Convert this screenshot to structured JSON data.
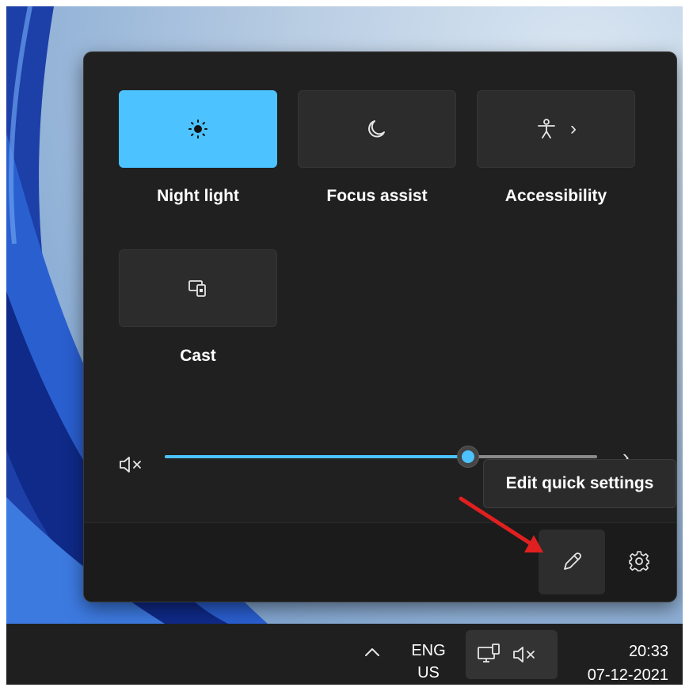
{
  "quick_settings": {
    "tiles": [
      {
        "label": "Night light",
        "icon": "night-light-icon",
        "active": true
      },
      {
        "label": "Focus assist",
        "icon": "moon-icon",
        "active": false
      },
      {
        "label": "Accessibility",
        "icon": "accessibility-icon",
        "active": false,
        "has_chevron": true
      },
      {
        "label": "Cast",
        "icon": "cast-icon",
        "active": false
      }
    ],
    "volume": {
      "muted_icon": "speaker-muted-icon",
      "level_percent": 70
    },
    "footer": {
      "edit_icon": "pencil-icon",
      "settings_icon": "gear-icon"
    },
    "tooltip": "Edit quick settings"
  },
  "taskbar": {
    "lang_primary": "ENG",
    "lang_secondary": "US",
    "time": "20:33",
    "date": "07-12-2021"
  },
  "colors": {
    "accent": "#4cc2ff",
    "panel": "#202020",
    "annotation_arrow": "#e0201f"
  }
}
